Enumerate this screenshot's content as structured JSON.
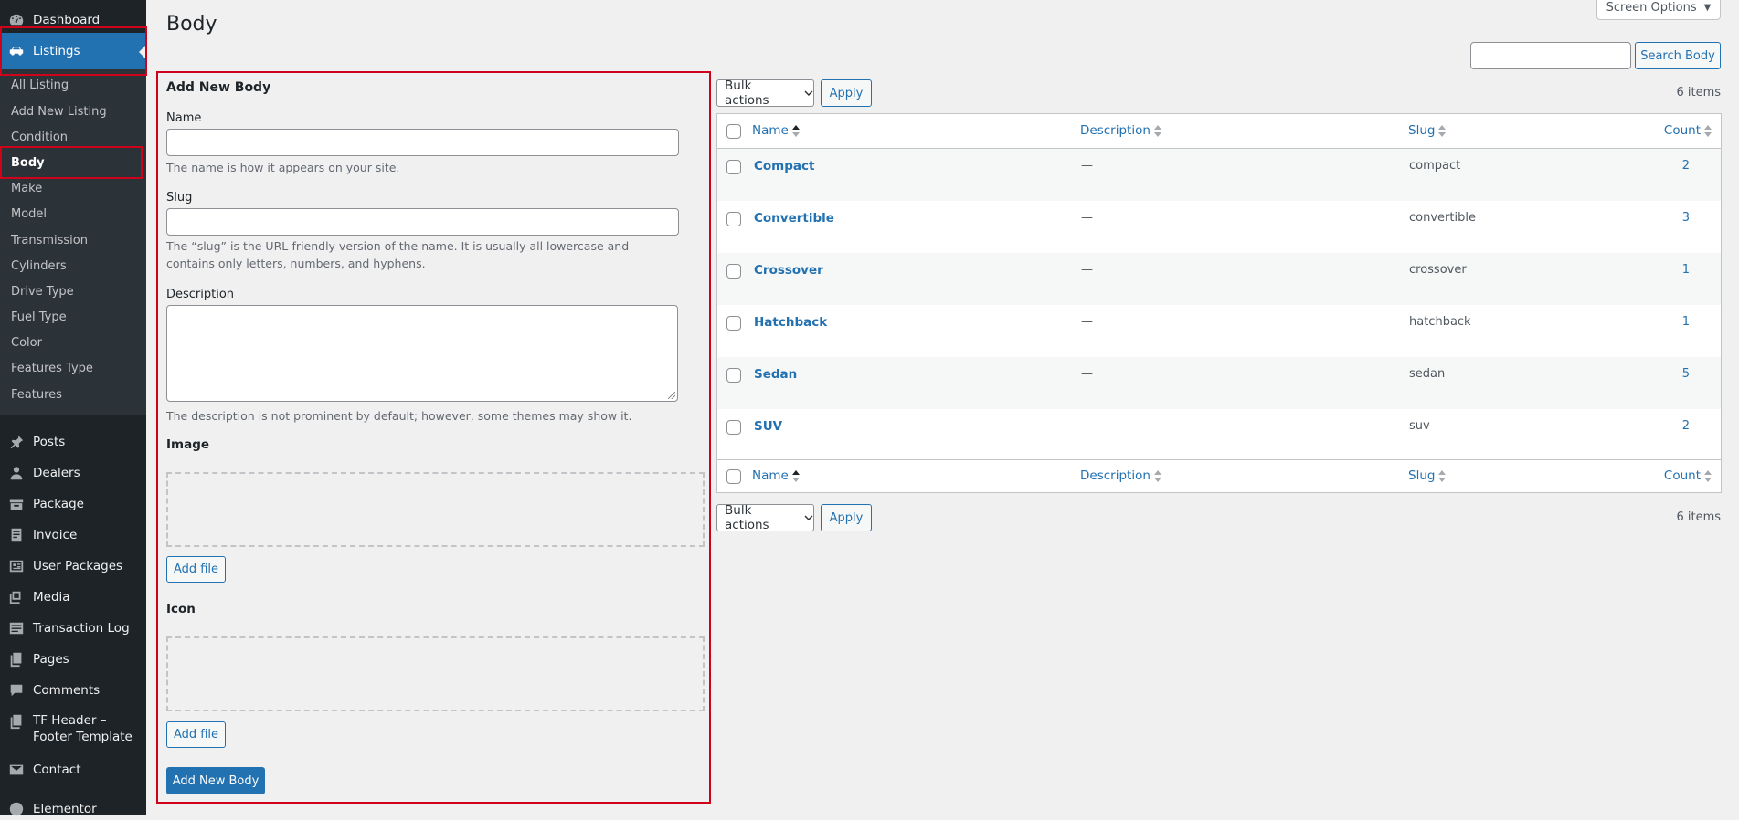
{
  "sidebar": {
    "top": [
      {
        "label": "Dashboard",
        "icon": "dashboard-icon"
      },
      {
        "label": "Listings",
        "icon": "car-icon"
      }
    ],
    "submenu": [
      "All Listing",
      "Add New Listing",
      "Condition",
      "Body",
      "Make",
      "Model",
      "Transmission",
      "Cylinders",
      "Drive Type",
      "Fuel Type",
      "Color",
      "Features Type",
      "Features"
    ],
    "current_submenu": "Body",
    "items": [
      {
        "label": "Posts",
        "icon": "pin-icon"
      },
      {
        "label": "Dealers",
        "icon": "person-icon"
      },
      {
        "label": "Package",
        "icon": "package-icon"
      },
      {
        "label": "Invoice",
        "icon": "invoice-icon"
      },
      {
        "label": "User Packages",
        "icon": "user-packages-icon"
      },
      {
        "label": "Media",
        "icon": "media-icon"
      },
      {
        "label": "Transaction Log",
        "icon": "transaction-log-icon"
      },
      {
        "label": "Pages",
        "icon": "pages-icon"
      },
      {
        "label": "Comments",
        "icon": "comments-icon"
      },
      {
        "label": "TF Header –\nFooter Template",
        "icon": "template-icon"
      },
      {
        "label": "Contact",
        "icon": "mail-icon"
      },
      {
        "label": "Elementor",
        "icon": "elementor-icon"
      }
    ]
  },
  "header": {
    "title": "Body",
    "screen_options": "Screen Options",
    "search_button": "Search Body",
    "search_value": ""
  },
  "form": {
    "heading": "Add New Body",
    "name_label": "Name",
    "name_help": "The name is how it appears on your site.",
    "slug_label": "Slug",
    "slug_help": "The “slug” is the URL-friendly version of the name. It is usually all lowercase and contains only letters, numbers, and hyphens.",
    "description_label": "Description",
    "description_help": "The description is not prominent by default; however, some themes may show it.",
    "image_label": "Image",
    "image_button": "Add file",
    "icon_label": "Icon",
    "icon_button": "Add file",
    "submit": "Add New Body"
  },
  "table": {
    "bulk_actions": "Bulk actions",
    "apply": "Apply",
    "items_count": "6 items",
    "columns": {
      "name": "Name",
      "description": "Description",
      "slug": "Slug",
      "count": "Count"
    },
    "rows": [
      {
        "name": "Compact",
        "description": "—",
        "slug": "compact",
        "count": "2"
      },
      {
        "name": "Convertible",
        "description": "—",
        "slug": "convertible",
        "count": "3"
      },
      {
        "name": "Crossover",
        "description": "—",
        "slug": "crossover",
        "count": "1"
      },
      {
        "name": "Hatchback",
        "description": "—",
        "slug": "hatchback",
        "count": "1"
      },
      {
        "name": "Sedan",
        "description": "—",
        "slug": "sedan",
        "count": "5"
      },
      {
        "name": "SUV",
        "description": "—",
        "slug": "suv",
        "count": "2"
      }
    ]
  },
  "colors": {
    "admin_bar": "#1d2327",
    "accent": "#2271b1",
    "highlight": "#d0021b"
  }
}
